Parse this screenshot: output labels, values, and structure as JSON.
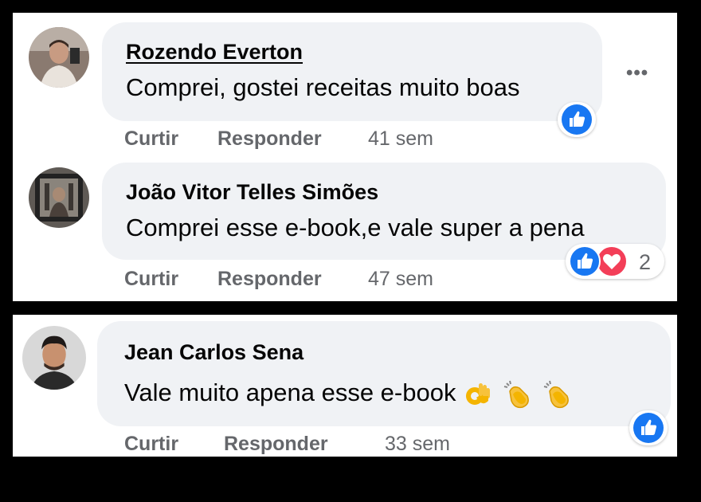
{
  "comments": [
    {
      "author": "Rozendo Everton",
      "text": "Comprei, gostei receitas muito boas",
      "actions": {
        "like": "Curtir",
        "reply": "Responder",
        "time": "41 sem"
      },
      "reactions": {
        "icons": [
          "like-icon"
        ],
        "count": ""
      },
      "more_icon": "•••"
    },
    {
      "author": "João Vitor Telles Simões",
      "text": "Comprei esse e-book,e vale super a pena",
      "actions": {
        "like": "Curtir",
        "reply": "Responder",
        "time": "47 sem"
      },
      "reactions": {
        "icons": [
          "like-icon",
          "love-icon"
        ],
        "count": "2"
      }
    },
    {
      "author": "Jean Carlos Sena",
      "text": "Vale muito apena esse e-book",
      "emojis": [
        "ok-hand-icon",
        "clapping-hands-icon",
        "clapping-hands-icon"
      ],
      "actions": {
        "like": "Curtir",
        "reply": "Responder",
        "time": "33 sem"
      },
      "reactions": {
        "icons": [
          "like-icon"
        ],
        "count": ""
      }
    }
  ],
  "colors": {
    "like_blue": "#1877f2",
    "love_red": "#f33e58",
    "bubble_bg": "#f0f2f5",
    "secondary_text": "#65676b"
  }
}
